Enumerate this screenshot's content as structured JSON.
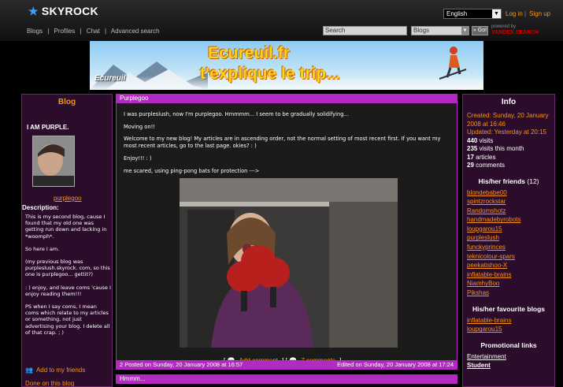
{
  "header": {
    "logo_text": "SKYROCK",
    "language": "English",
    "login_label": "Log in",
    "signup_label": "Sign up",
    "nav": [
      "Blogs",
      "|",
      "Profiles",
      "|",
      "Chat",
      "|",
      "Advanced search"
    ],
    "search_value": "Search",
    "search_scope": "Blogs",
    "go_label": "» Go!",
    "powered_by": "powered by",
    "powered_brand": "YANDEX SEARCH"
  },
  "banner": {
    "title": "Ecureuil.fr",
    "subtitle": "t'explique le trip...",
    "logo": "Ecureuil"
  },
  "left": {
    "title": "Blog",
    "tagline": "I AM PURPLE.",
    "username": "purplegoo",
    "description_title": "Description:",
    "description": [
      "This is my second blog, cause I found that my old one was getting run down and lacking in *woomph*.",
      "So here I am.",
      "(my previous blog was purpleslush.skyrock. com, so this one is purplegoo... gettit?)",
      ": ) enjoy, and leave coms 'cause I enjoy reading them!!!",
      "PS when I say coms, I mean coms which relate to my articles or something, not just advertising your blog. I delete all of that crap. ; )"
    ],
    "add_friends": "Add to my friends",
    "cut_link": "Done on this blog"
  },
  "post": {
    "title": "Purplegoo",
    "paragraphs": [
      "I was purpleslush, now I'm purplegoo. Hmmmm... I seem to be gradually solidifying...",
      "Moving on!!",
      "Welcome to my new blog! My articles are in ascending order, not the normal setting of most recent first. If you want my most recent articles, go to the last page. okies? : )",
      "Enjoy!!! : )",
      "me scared, using ping-pong bats for protection --->"
    ],
    "add_comment": "Add comment",
    "comments": "7 comments",
    "posted": "2 Posted on Sunday, 20 January 2008 at 16:57",
    "edited": "Edited on Sunday, 20 January 2008 at 17:24",
    "next_title": "Hmmm..."
  },
  "right": {
    "info_title": "Info",
    "created_label": "Created:",
    "created": "Sunday, 20 January 2008 at 16:46",
    "updated_label": "Updated:",
    "updated": "Yesterday at 20:15",
    "visits": "440",
    "visits_label": "visits",
    "visits_month": "235",
    "visits_month_label": "visits this month",
    "articles": "17",
    "articles_label": "articles",
    "comments": "29",
    "comments_label": "comments",
    "friends_title": "His/her friends",
    "friends_count": "(12)",
    "friends": [
      "blondebabe00",
      "spintzrockstar",
      "Randomshotz",
      "handmadebyrobots",
      "loupgarou15",
      "purpleslush",
      "funckyprinces",
      "teknicolour-spars",
      "peekatishoo-X",
      "inflatable-brains",
      "NiamhyBoo",
      "Pikshas"
    ],
    "fav_title": "His/her favourite blogs",
    "favs": [
      "inflatable-brains",
      "loupgarou15"
    ],
    "promo_title": "Promotional links",
    "promos": [
      "Entertainment",
      "Student"
    ]
  }
}
